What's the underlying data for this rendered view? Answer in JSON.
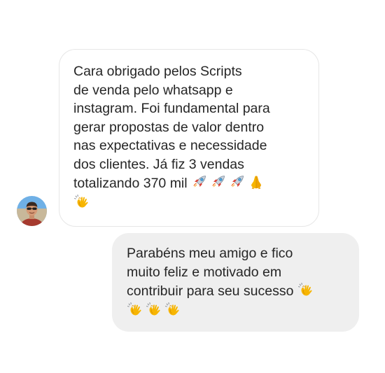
{
  "conversation": {
    "incoming_message": {
      "lines": [
        "Cara obrigado pelos Scripts",
        "de venda pelo whatsapp e",
        "instagram. Foi fundamental para",
        "gerar propostas de valor dentro",
        "nas expectativas e necessidade",
        "dos clientes. Já fiz 3 vendas",
        "totalizando 370 mil"
      ],
      "emojis": [
        "rocket-icon",
        "rocket-icon",
        "rocket-icon",
        "folded-hands-icon",
        "clapping-hands-icon"
      ]
    },
    "outgoing_message": {
      "lines": [
        "Parabéns meu amigo e fico",
        "muito feliz e motivado em",
        "contribuir para seu sucesso"
      ],
      "emojis": [
        "clapping-hands-icon",
        "clapping-hands-icon",
        "clapping-hands-icon",
        "clapping-hands-icon"
      ]
    },
    "colors": {
      "incoming_bubble_bg": "#ffffff",
      "incoming_bubble_border": "#e6e6e6",
      "outgoing_bubble_bg": "#efefef",
      "text": "#262626"
    }
  }
}
